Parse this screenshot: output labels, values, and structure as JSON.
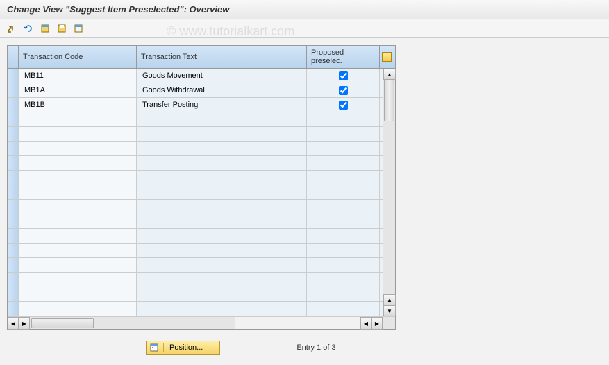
{
  "title": "Change View \"Suggest Item Preselected\": Overview",
  "watermark": "© www.tutorialkart.com",
  "toolbar": {
    "icons": [
      "toggle",
      "undo",
      "select-all",
      "save",
      "deselect"
    ]
  },
  "table": {
    "columns": {
      "code": "Transaction Code",
      "text": "Transaction Text",
      "proposed": "Proposed preselec."
    },
    "rows": [
      {
        "code": "MB11",
        "text": "Goods Movement",
        "proposed": true
      },
      {
        "code": "MB1A",
        "text": "Goods Withdrawal",
        "proposed": true
      },
      {
        "code": "MB1B",
        "text": "Transfer Posting",
        "proposed": true
      },
      {
        "code": "",
        "text": "",
        "proposed": null
      },
      {
        "code": "",
        "text": "",
        "proposed": null
      },
      {
        "code": "",
        "text": "",
        "proposed": null
      },
      {
        "code": "",
        "text": "",
        "proposed": null
      },
      {
        "code": "",
        "text": "",
        "proposed": null
      },
      {
        "code": "",
        "text": "",
        "proposed": null
      },
      {
        "code": "",
        "text": "",
        "proposed": null
      },
      {
        "code": "",
        "text": "",
        "proposed": null
      },
      {
        "code": "",
        "text": "",
        "proposed": null
      },
      {
        "code": "",
        "text": "",
        "proposed": null
      },
      {
        "code": "",
        "text": "",
        "proposed": null
      },
      {
        "code": "",
        "text": "",
        "proposed": null
      },
      {
        "code": "",
        "text": "",
        "proposed": null
      },
      {
        "code": "",
        "text": "",
        "proposed": null
      }
    ]
  },
  "footer": {
    "position_label": "Position...",
    "entry_text": "Entry 1 of 3"
  }
}
